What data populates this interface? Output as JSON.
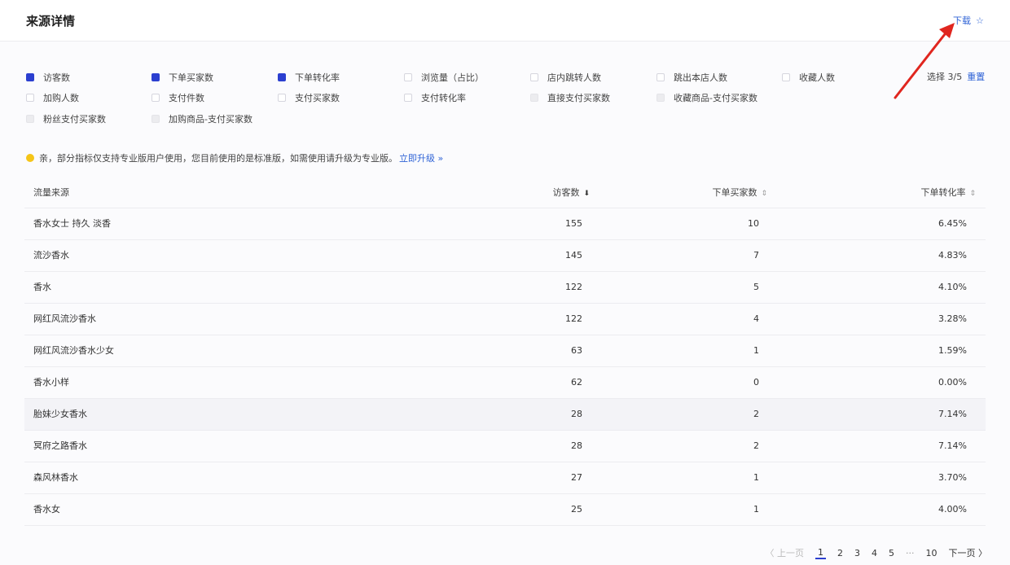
{
  "header": {
    "title": "来源详情",
    "download_label": "下载",
    "download_icon": "☆"
  },
  "metrics": [
    {
      "label": "访客数",
      "state": "checked"
    },
    {
      "label": "下单买家数",
      "state": "checked"
    },
    {
      "label": "下单转化率",
      "state": "checked"
    },
    {
      "label": "浏览量（占比）",
      "state": "unchecked"
    },
    {
      "label": "店内跳转人数",
      "state": "unchecked"
    },
    {
      "label": "跳出本店人数",
      "state": "unchecked"
    },
    {
      "label": "收藏人数",
      "state": "unchecked"
    },
    {
      "label": "加购人数",
      "state": "unchecked"
    },
    {
      "label": "支付件数",
      "state": "unchecked"
    },
    {
      "label": "支付买家数",
      "state": "unchecked"
    },
    {
      "label": "支付转化率",
      "state": "unchecked"
    },
    {
      "label": "直接支付买家数",
      "state": "disabled"
    },
    {
      "label": "收藏商品-支付买家数",
      "state": "disabled"
    },
    {
      "label": "粉丝支付买家数",
      "state": "disabled"
    },
    {
      "label": "加购商品-支付买家数",
      "state": "disabled"
    }
  ],
  "selection": {
    "count_text": "选择 3/5",
    "reset_label": "重置"
  },
  "notice": {
    "text": "亲，部分指标仅支持专业版用户使用，您目前使用的是标准版，如需使用请升级为专业版。",
    "link": "立即升级 »"
  },
  "table": {
    "columns": [
      {
        "label": "流量来源"
      },
      {
        "label": "访客数",
        "sort_icon": "⬇"
      },
      {
        "label": "下单买家数",
        "sort_icon": "⇕"
      },
      {
        "label": "下单转化率",
        "sort_icon": "⇕"
      }
    ],
    "rows": [
      {
        "source": "香水女士 持久 淡香",
        "visitors": "155",
        "orders": "10",
        "rate": "6.45%"
      },
      {
        "source": "流沙香水",
        "visitors": "145",
        "orders": "7",
        "rate": "4.83%"
      },
      {
        "source": "香水",
        "visitors": "122",
        "orders": "5",
        "rate": "4.10%"
      },
      {
        "source": "网红风流沙香水",
        "visitors": "122",
        "orders": "4",
        "rate": "3.28%"
      },
      {
        "source": "网红风流沙香水少女",
        "visitors": "63",
        "orders": "1",
        "rate": "1.59%"
      },
      {
        "source": "香水小样",
        "visitors": "62",
        "orders": "0",
        "rate": "0.00%"
      },
      {
        "source": "胎妹少女香水",
        "visitors": "28",
        "orders": "2",
        "rate": "7.14%"
      },
      {
        "source": "冥府之路香水",
        "visitors": "28",
        "orders": "2",
        "rate": "7.14%"
      },
      {
        "source": "森风林香水",
        "visitors": "27",
        "orders": "1",
        "rate": "3.70%"
      },
      {
        "source": "香水女",
        "visitors": "25",
        "orders": "1",
        "rate": "4.00%"
      }
    ]
  },
  "pagination": {
    "prev": "〈 上一页",
    "pages": [
      "1",
      "2",
      "3",
      "4",
      "5"
    ],
    "ellipsis": "···",
    "last": "10",
    "next": "下一页 〉",
    "current": "1"
  },
  "colors": {
    "accent": "#2f63d6",
    "checkbox": "#2b3fd0",
    "notice_dot": "#f5c518",
    "arrow": "#e0261f"
  }
}
